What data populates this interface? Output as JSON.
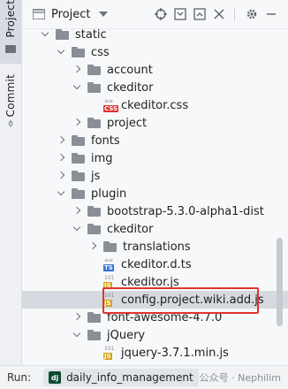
{
  "sidebar": {
    "tabs": [
      {
        "label": "Project",
        "icon": "folder-icon"
      },
      {
        "label": "Commit",
        "icon": "commit-icon"
      }
    ]
  },
  "header": {
    "title": "Project",
    "icons": [
      "locate-icon",
      "collapse-all-icon",
      "expand-all-icon",
      "close-icon",
      "gear-icon",
      "minimize-icon"
    ]
  },
  "tree": [
    {
      "label": "static",
      "type": "folder",
      "expanded": true
    },
    {
      "label": "css",
      "type": "folder",
      "expanded": true
    },
    {
      "label": "account",
      "type": "folder",
      "expanded": false
    },
    {
      "label": "ckeditor",
      "type": "folder",
      "expanded": true
    },
    {
      "label": "ckeditor.css",
      "type": "css"
    },
    {
      "label": "project",
      "type": "folder",
      "expanded": false
    },
    {
      "label": "fonts",
      "type": "folder",
      "expanded": false
    },
    {
      "label": "img",
      "type": "folder",
      "expanded": false
    },
    {
      "label": "js",
      "type": "folder",
      "expanded": false
    },
    {
      "label": "plugin",
      "type": "folder",
      "expanded": true
    },
    {
      "label": "bootstrap-5.3.0-alpha1-dist",
      "type": "folder",
      "expanded": false
    },
    {
      "label": "ckeditor",
      "type": "folder",
      "expanded": true
    },
    {
      "label": "translations",
      "type": "folder",
      "expanded": false
    },
    {
      "label": "ckeditor.d.ts",
      "type": "ts"
    },
    {
      "label": "ckeditor.js",
      "type": "js"
    },
    {
      "label": "config.project.wiki.add.js",
      "type": "js",
      "selected": true
    },
    {
      "label": "font-awesome-4.7.0",
      "type": "folder",
      "expanded": false
    },
    {
      "label": "jQuery",
      "type": "folder",
      "expanded": true
    },
    {
      "label": "jquery-3.7.1.min.js",
      "type": "js"
    }
  ],
  "runbar": {
    "label": "Run:",
    "tab_icon": "dj",
    "tab_name": "daily_info_management"
  },
  "watermark": "公众号 · Nephilim",
  "colors": {
    "highlight": "#e0342e",
    "selection": "#d6d9df",
    "css_badge": "#e0342e",
    "ts_badge": "#2f6fd6",
    "js_badge": "#d4a017"
  }
}
